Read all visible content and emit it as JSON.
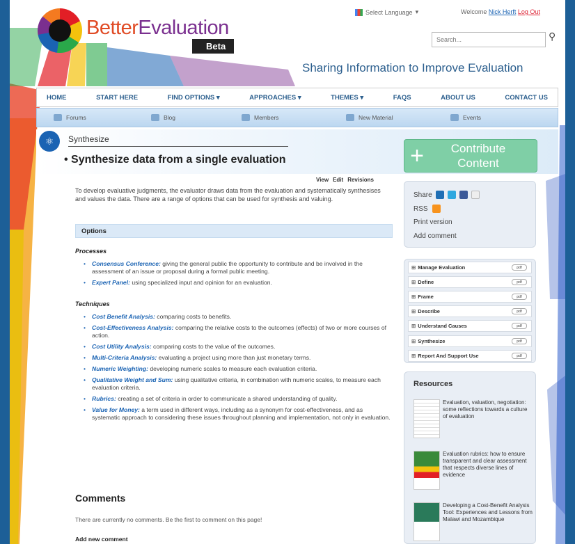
{
  "header": {
    "language_label": "Select Language",
    "welcome_text": "Welcome",
    "user_name": "Nick Herft",
    "logout_label": "Log Out",
    "search_placeholder": "Search...",
    "logo_better": "Better",
    "logo_evaluation": "Evaluation",
    "beta_label": "Beta",
    "tagline": "Sharing Information to Improve Evaluation"
  },
  "nav": {
    "items": [
      "HOME",
      "START HERE",
      "FIND OPTIONS ▾",
      "APPROACHES ▾",
      "THEMES ▾",
      "FAQS",
      "ABOUT US",
      "CONTACT US"
    ]
  },
  "subnav": {
    "items": [
      "Forums",
      "Blog",
      "Members",
      "New Material",
      "Events"
    ]
  },
  "page": {
    "breadcrumb": "Synthesize",
    "title": "• Synthesize data from a single evaluation",
    "contribute_plus": "+",
    "contribute_label": "Contribute Content",
    "tab_view": "View",
    "tab_edit": "Edit",
    "tab_revisions": "Revisions",
    "intro": "To develop evaluative judgments, the evaluator draws data from the evaluation and systematically synthesises and values the data. There are a range of options that can be used for synthesis and valuing.",
    "options_heading": "Options",
    "processes_heading": "Processes",
    "techniques_heading": "Techniques",
    "processes": [
      {
        "term": "Consensus Conference:",
        "desc": " giving the general public the opportunity to contribute and be involved in the assessment of an issue or proposal during a formal public meeting."
      },
      {
        "term": "Expert Panel:",
        "desc": " using specialized input and opinion for an evaluation."
      }
    ],
    "techniques": [
      {
        "term": "Cost Benefit Analysis:",
        "desc": " comparing costs to benefits."
      },
      {
        "term": "Cost-Effectiveness Analysis:",
        "desc": " comparing the relative costs to the outcomes (effects) of two or more courses of action."
      },
      {
        "term": "Cost Utility Analysis:",
        "desc": " comparing costs to the value of the outcomes."
      },
      {
        "term": "Multi-Criteria Analysis:",
        "desc": " evaluating a project using more than just monetary terms."
      },
      {
        "term": "Numeric Weighting:",
        "desc": " developing numeric scales to measure each evaluation criteria."
      },
      {
        "term": "Qualitative Weight and Sum:",
        "desc": " using qualitative criteria, in combination with numeric scales, to measure each evaluation criteria."
      },
      {
        "term": "Rubrics:",
        "desc": " creating a set of criteria in order to communicate a shared understanding of quality."
      },
      {
        "term": "Value for Money:",
        "desc": " a term used in different ways, including as a synonym for cost-effectiveness, and as systematic approach to considering these issues throughout planning and implementation, not only in evaluation."
      }
    ],
    "comments_heading": "Comments",
    "comments_text": "There are currently no comments. Be the first to comment on this page!",
    "add_comment_heading": "Add new comment"
  },
  "sidebar": {
    "share_label": "Share",
    "rss_label": "RSS",
    "print_label": "Print version",
    "add_comment_label": "Add comment",
    "clusters": [
      "Manage Evaluation",
      "Define",
      "Frame",
      "Describe",
      "Understand Causes",
      "Synthesize",
      "Report And Support Use"
    ],
    "cluster_tag": "pdf",
    "resources_heading": "Resources",
    "resources": [
      "Evaluation, valuation, negotiation: some reflections towards a culture of evaluation",
      "Evaluation rubrics: how to ensure transparent and clear assessment that respects diverse lines of evidence",
      "Developing a Cost-Benefit Analysis Tool: Experiences and Lessons from Malawi and Mozambique"
    ]
  },
  "colors": {
    "frame_bg": "#1d5f97",
    "link_blue": "#1a63b3",
    "contribute_green": "#7fcfa6",
    "options_bar": "#dbe9f7"
  }
}
